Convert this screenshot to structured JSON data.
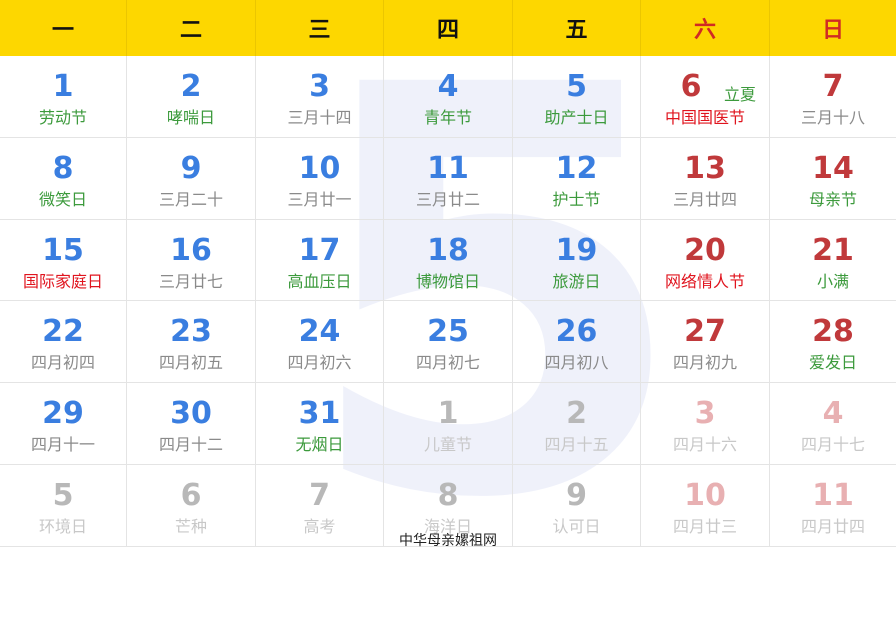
{
  "month_watermark": "5",
  "weekdays": [
    "一",
    "二",
    "三",
    "四",
    "五",
    "六",
    "日"
  ],
  "footer_credit": "中华母亲嫘祖网",
  "weeks": [
    [
      {
        "day": "1",
        "sub": "劳动节",
        "day_style": "blue",
        "sub_style": "green"
      },
      {
        "day": "2",
        "sub": "哮喘日",
        "day_style": "blue",
        "sub_style": "green"
      },
      {
        "day": "3",
        "sub": "三月十四",
        "day_style": "blue",
        "sub_style": "gray"
      },
      {
        "day": "4",
        "sub": "青年节",
        "day_style": "blue",
        "sub_style": "green"
      },
      {
        "day": "5",
        "sub": "助产士日",
        "day_style": "blue",
        "sub_style": "green"
      },
      {
        "day": "6",
        "sub": "中国国医节",
        "day_style": "red",
        "sub_style": "red",
        "term": "立夏"
      },
      {
        "day": "7",
        "sub": "三月十八",
        "day_style": "red",
        "sub_style": "gray"
      }
    ],
    [
      {
        "day": "8",
        "sub": "微笑日",
        "day_style": "blue",
        "sub_style": "green"
      },
      {
        "day": "9",
        "sub": "三月二十",
        "day_style": "blue",
        "sub_style": "gray"
      },
      {
        "day": "10",
        "sub": "三月廿一",
        "day_style": "blue",
        "sub_style": "gray"
      },
      {
        "day": "11",
        "sub": "三月廿二",
        "day_style": "blue",
        "sub_style": "gray"
      },
      {
        "day": "12",
        "sub": "护士节",
        "day_style": "blue",
        "sub_style": "green"
      },
      {
        "day": "13",
        "sub": "三月廿四",
        "day_style": "red",
        "sub_style": "gray"
      },
      {
        "day": "14",
        "sub": "母亲节",
        "day_style": "red",
        "sub_style": "green"
      }
    ],
    [
      {
        "day": "15",
        "sub": "国际家庭日",
        "day_style": "blue",
        "sub_style": "red"
      },
      {
        "day": "16",
        "sub": "三月廿七",
        "day_style": "blue",
        "sub_style": "gray"
      },
      {
        "day": "17",
        "sub": "高血压日",
        "day_style": "blue",
        "sub_style": "green"
      },
      {
        "day": "18",
        "sub": "博物馆日",
        "day_style": "blue",
        "sub_style": "green"
      },
      {
        "day": "19",
        "sub": "旅游日",
        "day_style": "blue",
        "sub_style": "green"
      },
      {
        "day": "20",
        "sub": "网络情人节",
        "day_style": "red",
        "sub_style": "red"
      },
      {
        "day": "21",
        "sub": "小满",
        "day_style": "red",
        "sub_style": "green"
      }
    ],
    [
      {
        "day": "22",
        "sub": "四月初四",
        "day_style": "blue",
        "sub_style": "gray"
      },
      {
        "day": "23",
        "sub": "四月初五",
        "day_style": "blue",
        "sub_style": "gray"
      },
      {
        "day": "24",
        "sub": "四月初六",
        "day_style": "blue",
        "sub_style": "gray"
      },
      {
        "day": "25",
        "sub": "四月初七",
        "day_style": "blue",
        "sub_style": "gray"
      },
      {
        "day": "26",
        "sub": "四月初八",
        "day_style": "blue",
        "sub_style": "gray"
      },
      {
        "day": "27",
        "sub": "四月初九",
        "day_style": "red",
        "sub_style": "gray"
      },
      {
        "day": "28",
        "sub": "爱发日",
        "day_style": "red",
        "sub_style": "green"
      }
    ],
    [
      {
        "day": "29",
        "sub": "四月十一",
        "day_style": "blue",
        "sub_style": "gray"
      },
      {
        "day": "30",
        "sub": "四月十二",
        "day_style": "blue",
        "sub_style": "gray"
      },
      {
        "day": "31",
        "sub": "无烟日",
        "day_style": "blue",
        "sub_style": "green"
      },
      {
        "day": "1",
        "sub": "儿童节",
        "day_style": "faded",
        "sub_style": "faded"
      },
      {
        "day": "2",
        "sub": "四月十五",
        "day_style": "faded",
        "sub_style": "faded"
      },
      {
        "day": "3",
        "sub": "四月十六",
        "day_style": "faded-red",
        "sub_style": "faded"
      },
      {
        "day": "4",
        "sub": "四月十七",
        "day_style": "faded-red",
        "sub_style": "faded"
      }
    ],
    [
      {
        "day": "5",
        "sub": "环境日",
        "day_style": "faded",
        "sub_style": "faded"
      },
      {
        "day": "6",
        "sub": "芒种",
        "day_style": "faded",
        "sub_style": "faded"
      },
      {
        "day": "7",
        "sub": "高考",
        "day_style": "faded",
        "sub_style": "faded"
      },
      {
        "day": "8",
        "sub": "海洋日",
        "day_style": "faded",
        "sub_style": "faded"
      },
      {
        "day": "9",
        "sub": "认可日",
        "day_style": "faded",
        "sub_style": "faded"
      },
      {
        "day": "10",
        "sub": "四月廿三",
        "day_style": "faded-red",
        "sub_style": "faded"
      },
      {
        "day": "11",
        "sub": "四月廿四",
        "day_style": "faded-red",
        "sub_style": "faded"
      }
    ]
  ],
  "colors": {
    "header_bg": "#fdd700",
    "weekday_text": "#111111",
    "weekend_header_text": "#d02a24",
    "weekday_number": "#3a7ee0",
    "weekend_number": "#c0393b",
    "festival_green": "#3c9a3c",
    "festival_red": "#e0141e",
    "lunar_gray": "#8a8a8a"
  }
}
